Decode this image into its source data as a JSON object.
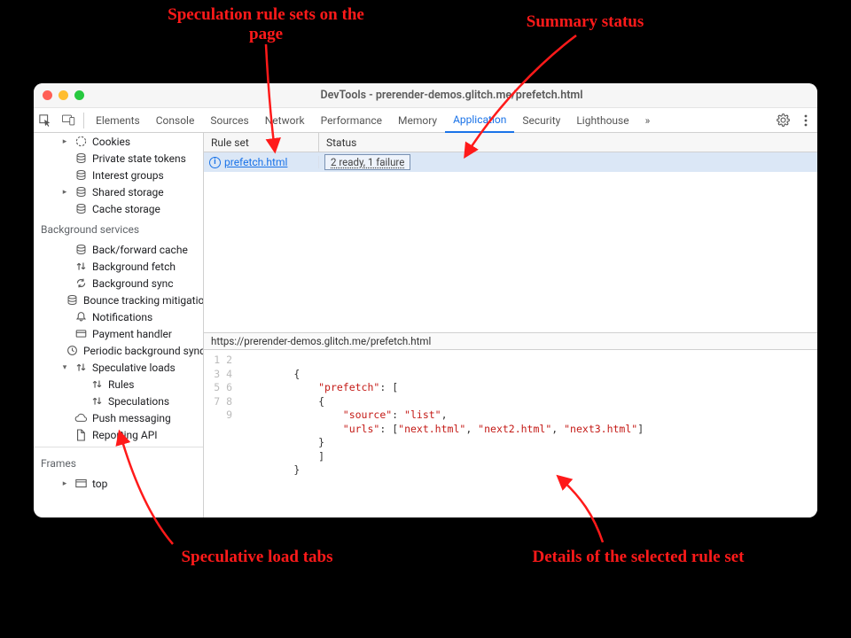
{
  "annotations": {
    "top_left": "Speculation rule sets\non the page",
    "top_right": "Summary status",
    "bottom_left": "Speculative load tabs",
    "bottom_right": "Details of the selected rule set"
  },
  "window": {
    "title": "DevTools - prerender-demos.glitch.me/prefetch.html"
  },
  "tabs": {
    "items": [
      "Elements",
      "Console",
      "Sources",
      "Network",
      "Performance",
      "Memory",
      "Application",
      "Security",
      "Lighthouse"
    ],
    "active": "Application",
    "more_glyph": "»"
  },
  "sidebar": {
    "app_items": [
      {
        "label": "Cookies",
        "icon": "cookie",
        "arrow": "▸"
      },
      {
        "label": "Private state tokens",
        "icon": "db"
      },
      {
        "label": "Interest groups",
        "icon": "db"
      },
      {
        "label": "Shared storage",
        "icon": "db",
        "arrow": "▸"
      },
      {
        "label": "Cache storage",
        "icon": "db"
      }
    ],
    "bg_header": "Background services",
    "bg_items": [
      {
        "label": "Back/forward cache",
        "icon": "db"
      },
      {
        "label": "Background fetch",
        "icon": "updown"
      },
      {
        "label": "Background sync",
        "icon": "sync"
      },
      {
        "label": "Bounce tracking mitigations",
        "icon": "db"
      },
      {
        "label": "Notifications",
        "icon": "bell"
      },
      {
        "label": "Payment handler",
        "icon": "card"
      },
      {
        "label": "Periodic background sync",
        "icon": "clock"
      },
      {
        "label": "Speculative loads",
        "icon": "updown",
        "arrow": "▾",
        "expanded": true
      }
    ],
    "spec_children": [
      {
        "label": "Rules",
        "icon": "updown"
      },
      {
        "label": "Speculations",
        "icon": "updown"
      }
    ],
    "after_spec": [
      {
        "label": "Push messaging",
        "icon": "cloud"
      },
      {
        "label": "Reporting API",
        "icon": "doc"
      }
    ],
    "frames_header": "Frames",
    "frames_items": [
      {
        "label": "top",
        "icon": "frame",
        "arrow": "▸"
      }
    ]
  },
  "ruleset": {
    "col1_header": "Rule set",
    "col2_header": "Status",
    "row": {
      "link_text": "prefetch.html",
      "status_text": "2 ready, 1 failure"
    },
    "detail_url": "https://prerender-demos.glitch.me/prefetch.html"
  },
  "code": {
    "line_count": 9,
    "json": {
      "prefetch": [
        {
          "source": "list",
          "urls": [
            "next.html",
            "next2.html",
            "next3.html"
          ]
        }
      ]
    }
  }
}
